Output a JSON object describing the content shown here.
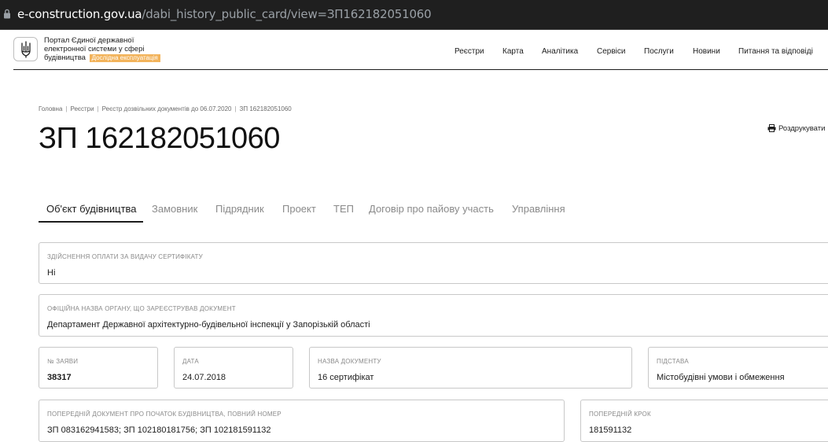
{
  "browser": {
    "url_domain": "e-construction.gov.ua",
    "url_path": "/dabi_history_public_card/view=ЗП162182051060"
  },
  "header": {
    "portal_title": "Портал Єдиної державної електронної системи у сфері будівництва",
    "beta_badge": "Дослідна експлуатація",
    "nav": [
      "Реєстри",
      "Карта",
      "Аналітика",
      "Сервіси",
      "Послуги",
      "Новини",
      "Питання та відповіді"
    ]
  },
  "breadcrumb": [
    "Головна",
    "Реєстри",
    "Реєстр дозвільних документів до 06.07.2020",
    "ЗП 162182051060"
  ],
  "page_title": "ЗП 162182051060",
  "print_label": "Роздрукувати",
  "tabs": [
    "Об'єкт будівництва",
    "Замовник",
    "Підрядник",
    "Проект",
    "ТЕП",
    "Договір про пайову участь",
    "Управління"
  ],
  "active_tab": "Об'єкт будівництва",
  "fields": {
    "payment": {
      "label": "Здійснення оплати за видачу сертифікату",
      "value": "Ні"
    },
    "authority": {
      "label": "Офіційна назва органу, що зареєстрував документ",
      "value": "Департамент Державної архітектурно-будівельної інспекції у Запорізькій області"
    },
    "app_number": {
      "label": "№ заяви",
      "value": "38317"
    },
    "date": {
      "label": "Дата",
      "value": "24.07.2018"
    },
    "doc_name": {
      "label": "Назва документу",
      "value": "16 сертифікат"
    },
    "basis": {
      "label": "Підстава",
      "value": "Містобудівні умови і обмеження"
    },
    "prev_doc": {
      "label": "Попередній документ про початок будівництва, повний номер",
      "value": "ЗП 083162941583; ЗП 102180181756; ЗП 102181591132"
    },
    "prev_step": {
      "label": "Попередній крок",
      "value": "181591132"
    }
  },
  "colors": {
    "badge": "#f2b35b",
    "addressbar": "#1f1f1f",
    "border": "#c8c8c8"
  }
}
